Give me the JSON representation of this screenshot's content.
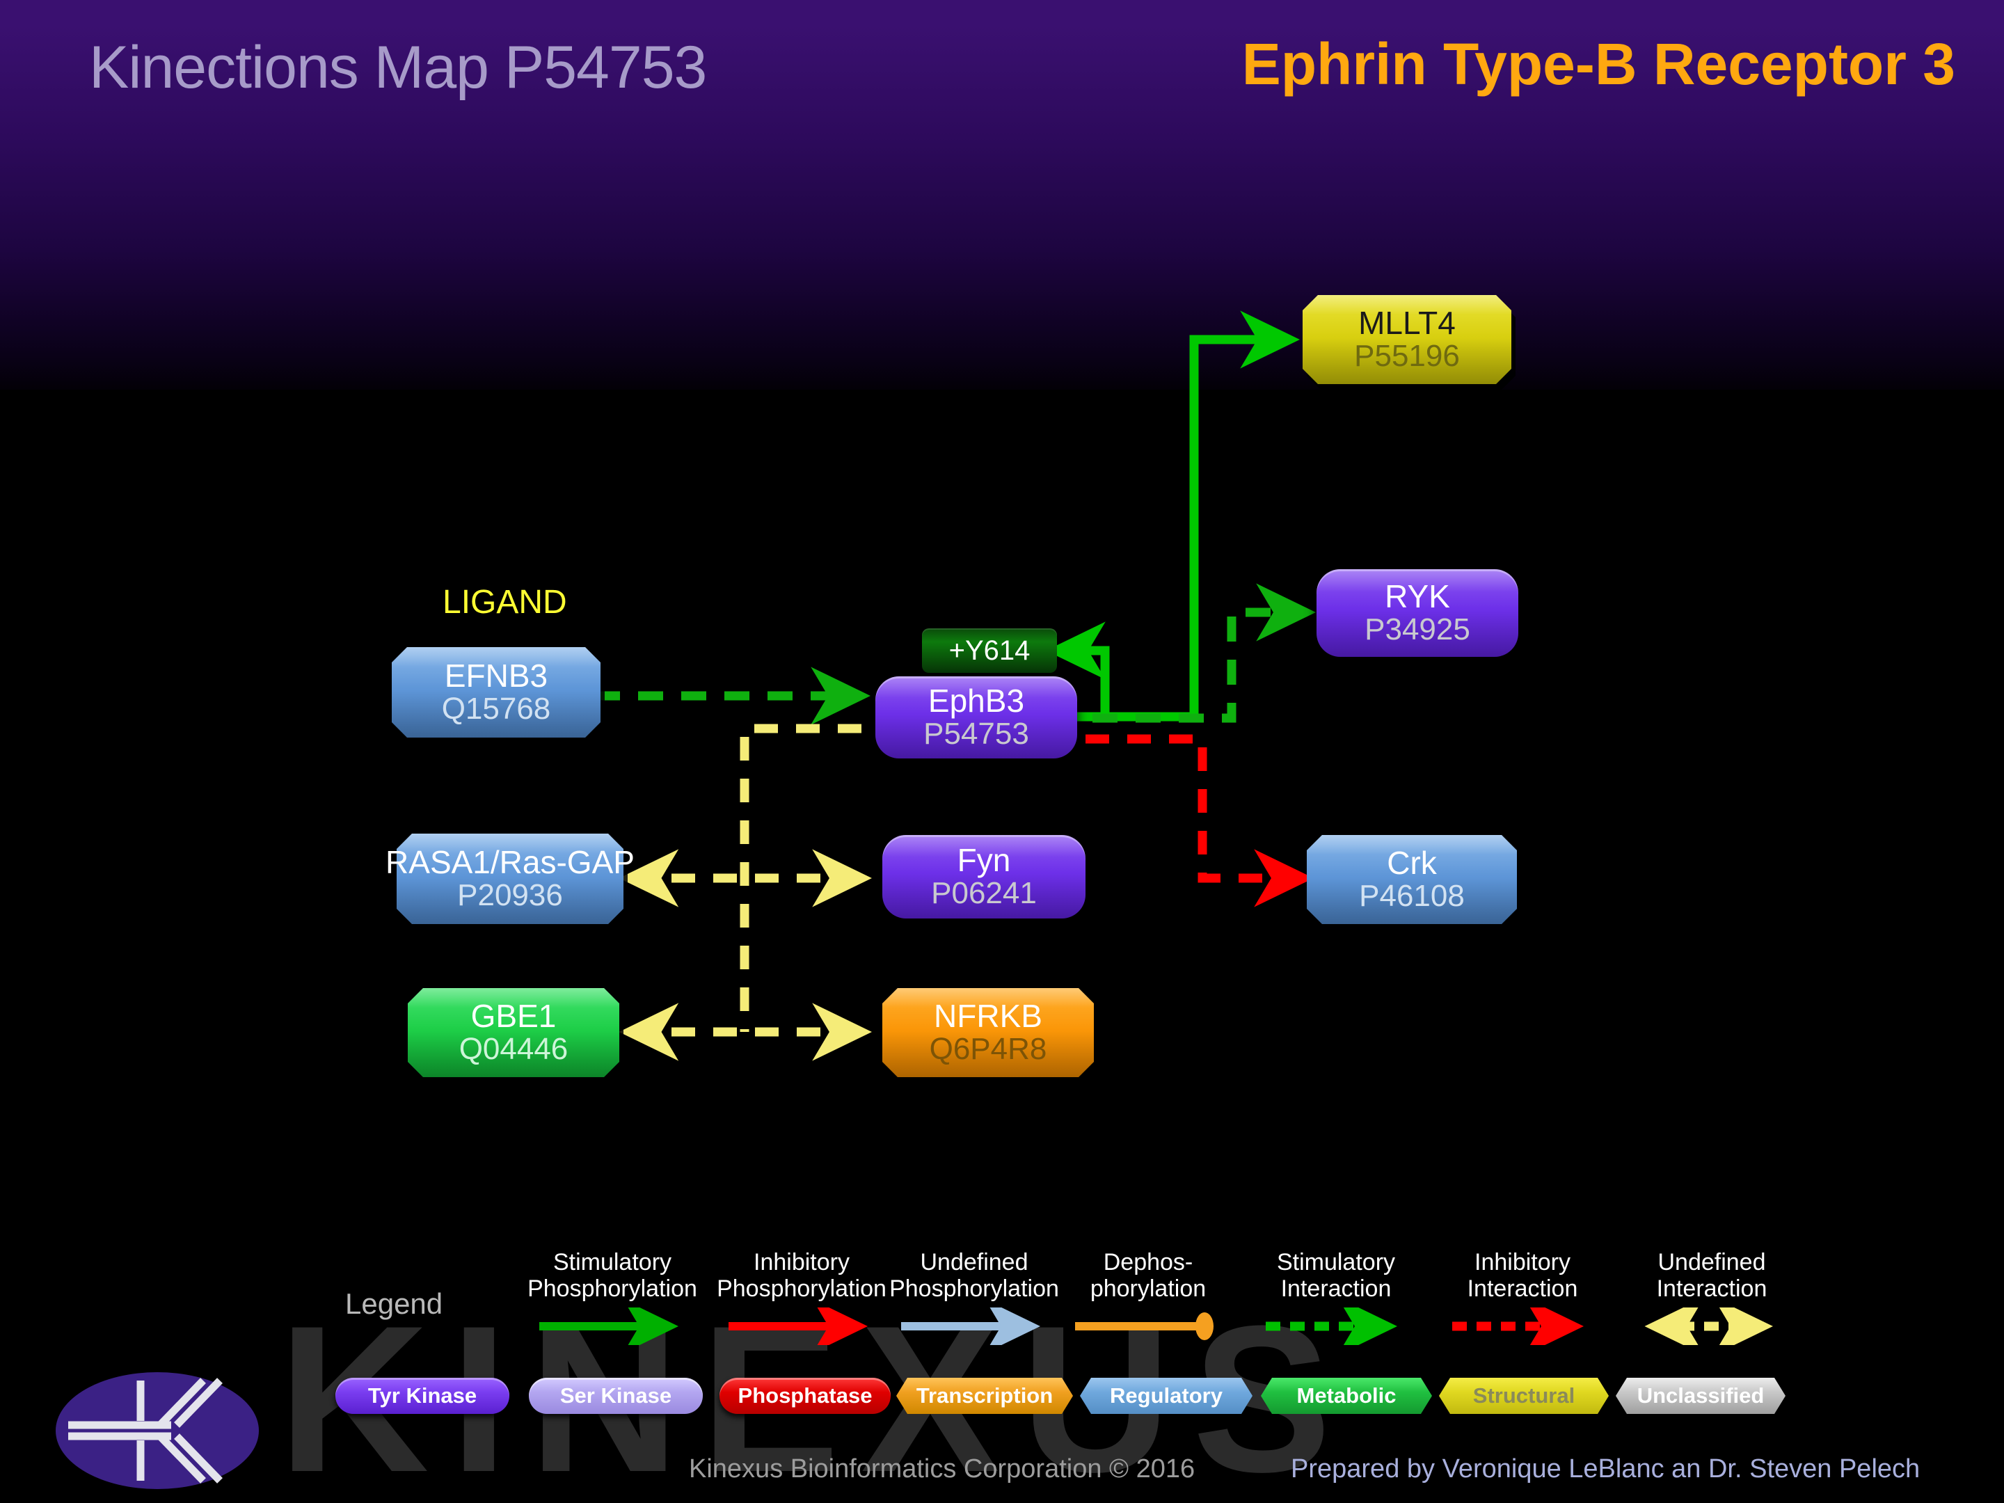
{
  "header": {
    "title_left": "Kinections Map P54753",
    "title_right": "Ephrin Type-B Receptor 3",
    "title_right_color": "#ffa810",
    "title_left_color": "#a79bc9"
  },
  "diagram": {
    "ligand_label": "LIGAND",
    "phosphosite": {
      "label": "+Y614",
      "color": "#0d7a0d"
    },
    "nodes": [
      {
        "id": "MLLT4",
        "name": "MLLT4",
        "accession": "P55196",
        "category": "Structural",
        "shape": "octagon",
        "color": "#d9d010"
      },
      {
        "id": "RYK",
        "name": "RYK",
        "accession": "P34925",
        "category": "Tyr Kinase",
        "shape": "rounded",
        "color": "#6c2fe8"
      },
      {
        "id": "EFNB3",
        "name": "EFNB3",
        "accession": "Q15768",
        "category": "Regulatory",
        "shape": "octagon",
        "color": "#5e96d8"
      },
      {
        "id": "EphB3",
        "name": "EphB3",
        "accession": "P54753",
        "category": "Tyr Kinase",
        "shape": "rounded",
        "color": "#6c2fe8"
      },
      {
        "id": "RASA1",
        "name": "RASA1/Ras-GAP",
        "accession": "P20936",
        "category": "Regulatory",
        "shape": "octagon",
        "color": "#5e96d8"
      },
      {
        "id": "Fyn",
        "name": "Fyn",
        "accession": "P06241",
        "category": "Tyr Kinase",
        "shape": "rounded",
        "color": "#6c2fe8"
      },
      {
        "id": "Crk",
        "name": "Crk",
        "accession": "P46108",
        "category": "Regulatory",
        "shape": "octagon",
        "color": "#5e96d8"
      },
      {
        "id": "GBE1",
        "name": "GBE1",
        "accession": "Q04446",
        "category": "Metabolic",
        "shape": "octagon",
        "color": "#1ecf48"
      },
      {
        "id": "NFRKB",
        "name": "NFRKB",
        "accession": "Q6P4R8",
        "category": "Transcription",
        "shape": "octagon",
        "color": "#fb9708"
      }
    ],
    "edges": [
      {
        "from": "EFNB3",
        "to": "EphB3",
        "type": "Stimulatory Interaction",
        "style": "dashed",
        "color": "#0fb00f"
      },
      {
        "from": "EphB3",
        "to": "+Y614",
        "type": "Stimulatory Phosphorylation",
        "style": "solid",
        "color": "#00c800"
      },
      {
        "from": "EphB3",
        "to": "MLLT4",
        "type": "Stimulatory Phosphorylation",
        "style": "solid",
        "color": "#00c800"
      },
      {
        "from": "EphB3",
        "to": "RYK",
        "type": "Stimulatory Interaction",
        "style": "dashed",
        "color": "#0fb00f"
      },
      {
        "from": "EphB3",
        "to": "Crk",
        "type": "Inhibitory Interaction",
        "style": "dashed",
        "color": "#ff0000"
      },
      {
        "from": "EphB3",
        "to": "Fyn",
        "type": "Undefined Interaction",
        "style": "dashed",
        "color": "#f5ec78"
      },
      {
        "from": "EphB3",
        "to": "RASA1",
        "type": "Undefined Interaction",
        "style": "dashed",
        "color": "#f5ec78"
      },
      {
        "from": "EphB3",
        "to": "NFRKB",
        "type": "Undefined Interaction",
        "style": "dashed",
        "color": "#f5ec78"
      },
      {
        "from": "EphB3",
        "to": "GBE1",
        "type": "Undefined Interaction",
        "style": "dashed",
        "color": "#f5ec78"
      }
    ]
  },
  "legend": {
    "title": "Legend",
    "items": [
      {
        "line1": "Stimulatory",
        "line2": "Phosphorylation",
        "art": "solid-arrow",
        "color": "#00b000"
      },
      {
        "line1": "Inhibitory",
        "line2": "Phosphorylation",
        "art": "solid-arrow",
        "color": "#ff0000"
      },
      {
        "line1": "Undefined",
        "line2": "Phosphorylation",
        "art": "solid-arrow",
        "color": "#9dbfe0"
      },
      {
        "line1": "Dephos-",
        "line2": "phorylation",
        "art": "solid-ball",
        "color": "#f5a020"
      },
      {
        "line1": "Stimulatory",
        "line2": "Interaction",
        "art": "dashed-arrow",
        "color": "#00c000"
      },
      {
        "line1": "Inhibitory",
        "line2": "Interaction",
        "art": "dashed-arrow",
        "color": "#ff0000"
      },
      {
        "line1": "Undefined",
        "line2": "Interaction",
        "art": "dashed-biarrow",
        "color": "#f5ec78"
      }
    ],
    "categories": [
      {
        "label": "Tyr Kinase",
        "shape": "rounded",
        "fill": "#6c2fe8",
        "text": "#ffffff"
      },
      {
        "label": "Ser Kinase",
        "shape": "rounded",
        "fill": "#b3a6f0",
        "text": "#ffffff"
      },
      {
        "label": "Phosphatase",
        "shape": "rounded",
        "fill": "#e00000",
        "text": "#ffffff"
      },
      {
        "label": "Transcription",
        "shape": "octagon",
        "fill": "#f0a020",
        "text": "#ffffff"
      },
      {
        "label": "Regulatory",
        "shape": "octagon",
        "fill": "#6fa8dd",
        "text": "#ffffff"
      },
      {
        "label": "Metabolic",
        "shape": "octagon",
        "fill": "#20c040",
        "text": "#ffffff"
      },
      {
        "label": "Structural",
        "shape": "octagon",
        "fill": "#e0d820",
        "text": "#8a8a5a"
      },
      {
        "label": "Unclassified",
        "shape": "octagon",
        "fill": "#c8c8c8",
        "text": "#ffffff"
      }
    ]
  },
  "footer": {
    "copyright": "Kinexus Bioinformatics Corporation © 2016",
    "prepared_by": "Prepared by Veronique LeBlanc an Dr. Steven Pelech",
    "watermark": "KINEXUS"
  }
}
